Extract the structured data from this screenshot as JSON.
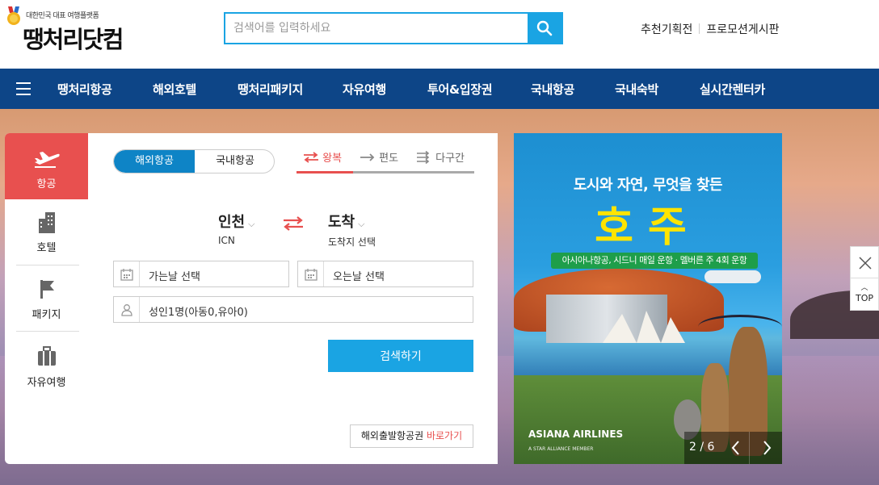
{
  "header": {
    "tagline": "대한민국 대표 여행플랫폼",
    "logo": "땡처리닷컴",
    "search": {
      "placeholder": "검색어를 입력하세요"
    },
    "links": [
      "추천기획전",
      "프로모션게시판"
    ]
  },
  "nav": {
    "items": [
      "땡처리항공",
      "해외호텔",
      "땡처리패키지",
      "자유여행",
      "투어&입장권",
      "국내항공",
      "국내숙박",
      "실시간렌터카"
    ]
  },
  "side_tabs": [
    "항공",
    "호텔",
    "패키지",
    "자유여행"
  ],
  "panel": {
    "toggle": {
      "on": "해외항공",
      "off": "국내항공"
    },
    "trip_tabs": [
      "왕복",
      "편도",
      "다구간"
    ],
    "origin": {
      "name": "인천",
      "code": "ICN"
    },
    "dest": {
      "name": "도착",
      "sub": "도착지 선택"
    },
    "depart_date": "가는날 선택",
    "return_date": "오는날 선택",
    "passengers": "성인1명(아동0,유아0)",
    "search_button": "검색하기",
    "airport_link": {
      "text": "해외출발항공권",
      "highlight": "바로가기"
    }
  },
  "banner": {
    "headline": "도시와 자연, 무엇을 찾든",
    "title": "호주",
    "pill": "아시아나항공, 시드니 매일 운항 · 멜버른 주 4회 운항",
    "brand": "ASIANA AIRLINES",
    "brand_sub": "A STAR ALLIANCE MEMBER",
    "counter": "2 / 6"
  },
  "float": {
    "top_label": "TOP"
  },
  "colors": {
    "nav": "#0d4587",
    "accent": "#1aa4e3",
    "red": "#e8504f",
    "toggle_on": "#0e84c6"
  }
}
